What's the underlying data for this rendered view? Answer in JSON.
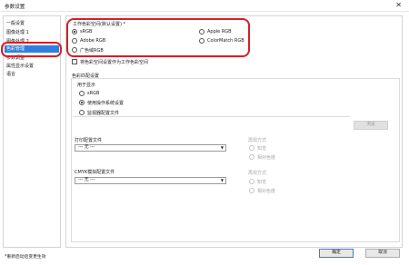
{
  "window": {
    "title": "参数设置",
    "close_glyph": "✕"
  },
  "sidebar": {
    "items": [
      {
        "label": "一般设置"
      },
      {
        "label": "图像处理 1"
      },
      {
        "label": "图像处理 2"
      },
      {
        "label": "色彩管理"
      },
      {
        "label": "参数调整"
      },
      {
        "label": "属性显示设置"
      },
      {
        "label": "语言"
      }
    ],
    "selected_index": 3
  },
  "workspace": {
    "label": "工作色彩空间(默认设置) *",
    "options": [
      {
        "label": "sRGB",
        "checked": true
      },
      {
        "label": "Apple RGB",
        "checked": false
      },
      {
        "label": "Adobe RGB",
        "checked": false
      },
      {
        "label": "ColorMatch RGB",
        "checked": false
      },
      {
        "label": "广色域RGB",
        "checked": false
      }
    ]
  },
  "embed_checkbox": {
    "label": "将色彩空间设置作为工作色彩空间",
    "checked": false
  },
  "color_matching": {
    "label": "色彩匹配设置",
    "display": {
      "label": "用于显示",
      "options": [
        {
          "label": "sRGB",
          "checked": false
        },
        {
          "label": "使用操作系统设置",
          "checked": true
        },
        {
          "label": "监视器配置文件",
          "checked": false
        }
      ],
      "apply_label": "浏览"
    },
    "printer": {
      "label": "打印配置文件",
      "select_value": "--- 无 ---",
      "intent_label": "再现方式",
      "intent_options": [
        {
          "label": "知觉",
          "disabled": true
        },
        {
          "label": "相对色度",
          "disabled": true
        }
      ]
    },
    "cmyk": {
      "label": "CMYK模拟配置文件",
      "select_value": "--- 无 ---",
      "intent_label": "再现方式",
      "intent_options": [
        {
          "label": "知觉",
          "disabled": true
        },
        {
          "label": "相对色度",
          "disabled": true
        }
      ]
    }
  },
  "footer": {
    "note": "*重新启动后变更生效",
    "ok_label": "确定",
    "cancel_label": "取消"
  },
  "colors": {
    "accent": "#2f7fe0",
    "highlight": "#d71f26"
  }
}
